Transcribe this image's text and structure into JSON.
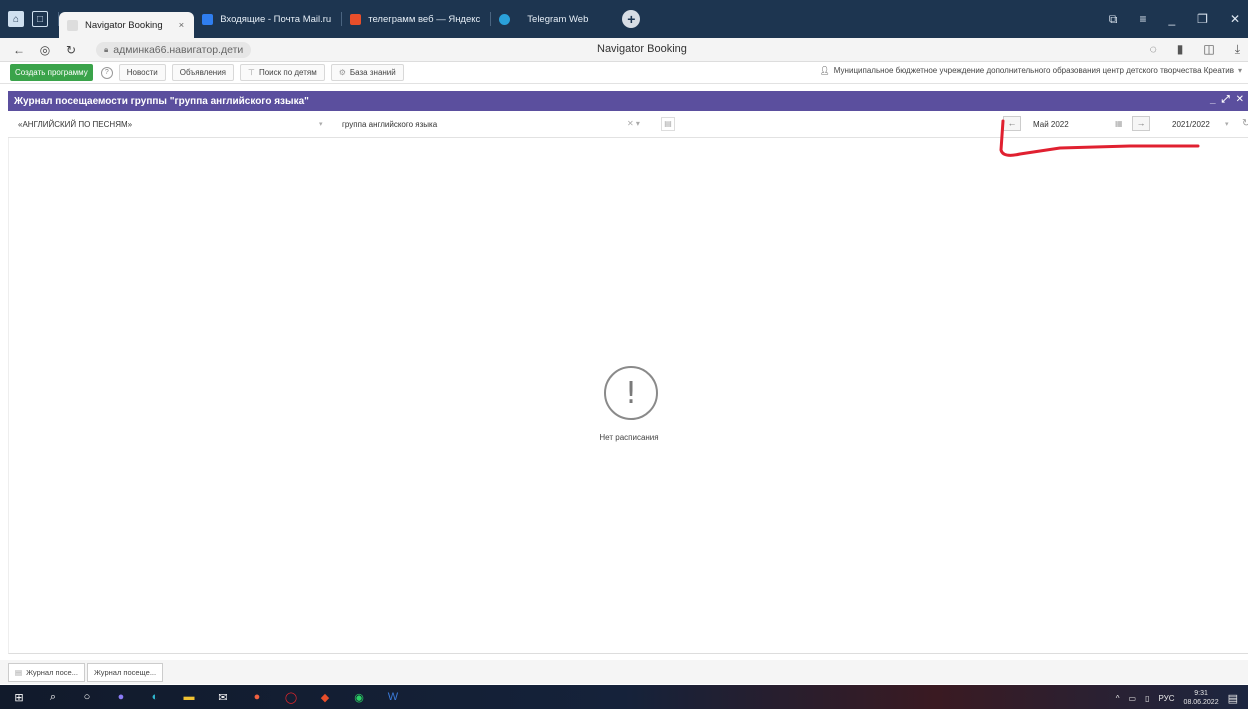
{
  "browser": {
    "tabs": [
      {
        "label": "Navigator Booking",
        "active": true
      },
      {
        "label": "Входящие - Почта Mail.ru"
      },
      {
        "label": "телеграмм веб — Яндекс"
      },
      {
        "label": "Telegram Web"
      }
    ],
    "close_glyph": "×",
    "url": "админка66.навигатор.дети",
    "page_title": "Navigator Booking"
  },
  "toolbar": {
    "create_label": "Создать программу",
    "news_label": "Новости",
    "announcements_label": "Объявления",
    "child_search_label": "Поиск по детям",
    "knowledge_base_label": "База знаний",
    "organization": "Муниципальное бюджетное учреждение дополнительного образования центр детского творчества Креатив"
  },
  "panel": {
    "title": "Журнал посещаемости группы \"группа английского языка\"",
    "program": "«АНГЛИЙСКИЙ ПО ПЕСНЯМ»",
    "group": "группа английского языка",
    "month": "Май 2022",
    "year": "2021/2022",
    "empty_text": "Нет расписания"
  },
  "open_windows": [
    {
      "label": "Журнал посе..."
    },
    {
      "label": "Журнал посеще..."
    }
  ],
  "taskbar": {
    "language": "РУС",
    "time": "9:31",
    "date": "08.06.2022"
  },
  "colors": {
    "panel_header": "#5b4f9e",
    "create_button": "#3aa34a",
    "tabbar": "#1d3550",
    "annotation": "#e02030"
  },
  "icons": [
    "home-icon",
    "back-icon",
    "refresh-icon",
    "lock-icon",
    "question-icon",
    "search-icon",
    "user-icon",
    "calendar-icon",
    "arrow-left-icon",
    "arrow-right-icon",
    "exclamation-icon",
    "windows-icon"
  ]
}
